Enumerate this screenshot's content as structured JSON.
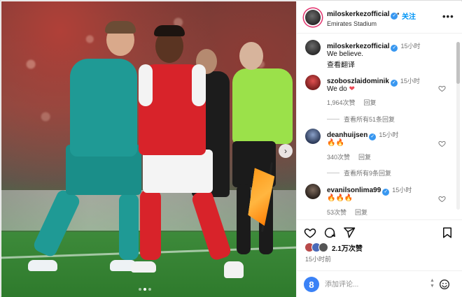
{
  "post": {
    "author": "miloskerkezofficial",
    "follow_separator": "•",
    "follow_label": "关注",
    "location": "Emirates Stadium",
    "more_label": "•••"
  },
  "photo": {
    "next_label": "›",
    "carousel_total": 3,
    "carousel_index": 2
  },
  "caption": {
    "user": "miloskerkezofficial",
    "time": "15小时",
    "text": "We believe.",
    "translate": "查看翻译"
  },
  "comments": [
    {
      "user": "szoboszlaidominik",
      "time": "15小时",
      "text": "We do",
      "emoji": "❤",
      "likes": "1,964次赞",
      "reply": "回复",
      "view_replies": "查看所有51条回复"
    },
    {
      "user": "deanhuijsen",
      "time": "15小时",
      "text": "🔥🔥",
      "likes": "340次赞",
      "reply": "回复",
      "view_replies": "查看所有9条回复"
    },
    {
      "user": "evanilsonlima99",
      "time": "15小时",
      "text": "🔥🔥🔥",
      "likes": "53次赞",
      "reply": "回复"
    }
  ],
  "stats": {
    "likes": "2.1万次赞",
    "posted": "15小时前"
  },
  "composer": {
    "avatar_letter": "8",
    "placeholder": "添加评论..."
  },
  "colors": {
    "link_blue": "#0095f6",
    "verified_blue": "#3897f0",
    "meta_gray": "#737373",
    "heart_red": "#ed4956"
  },
  "icons": [
    "verified-icon",
    "heart-icon",
    "comment-icon",
    "share-icon",
    "bookmark-icon",
    "emoji-icon",
    "chevron-right-icon",
    "more-icon"
  ]
}
